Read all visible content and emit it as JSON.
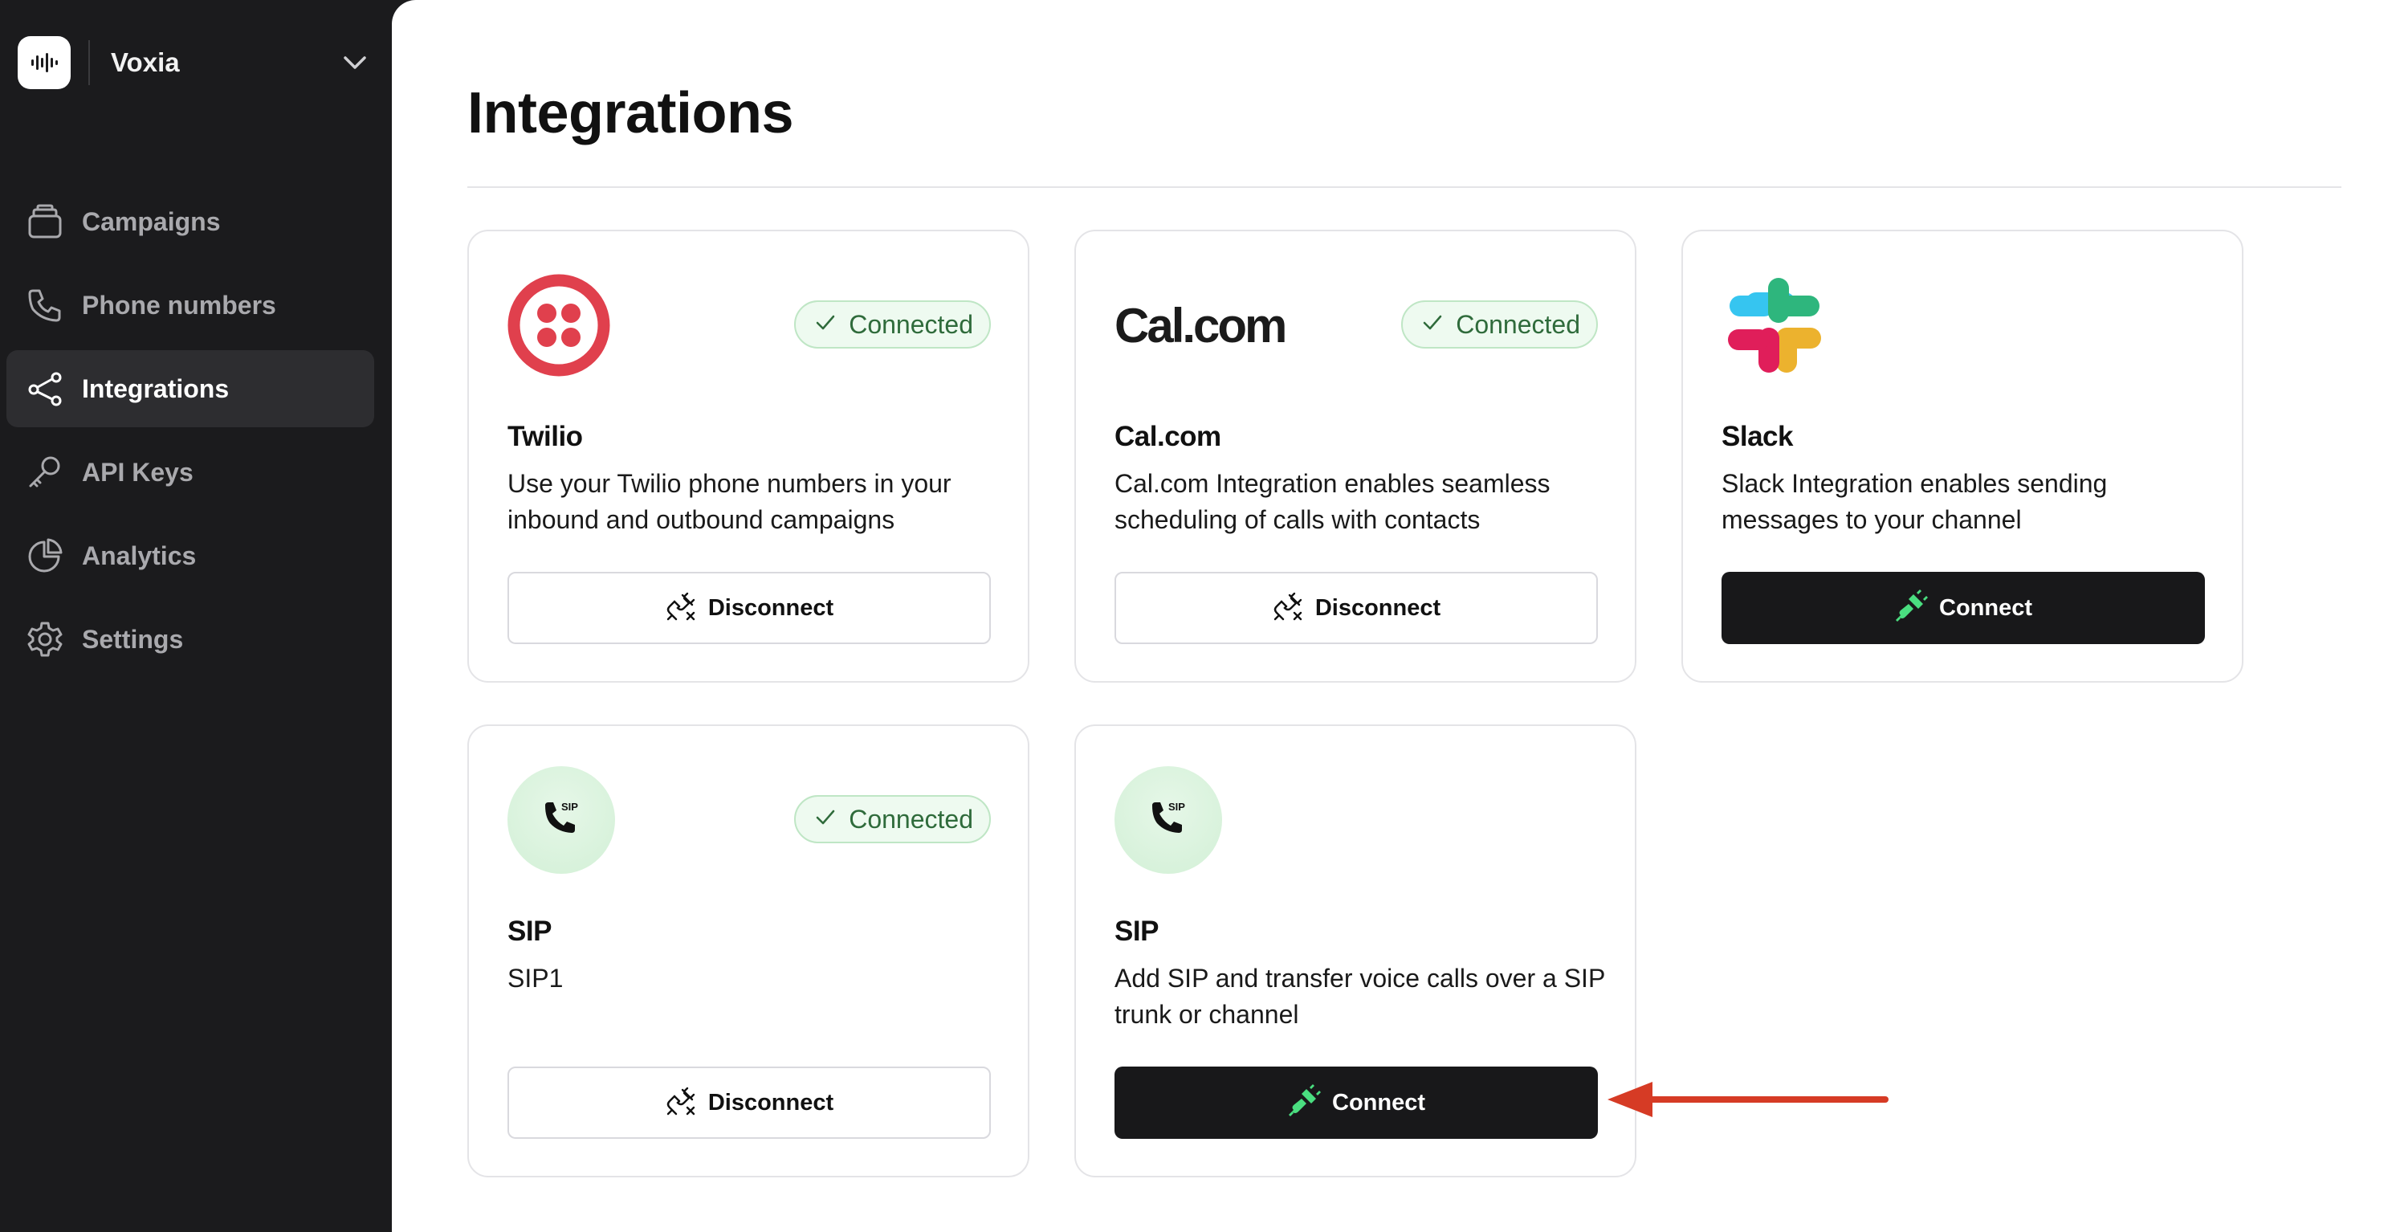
{
  "workspace": {
    "name": "Voxia",
    "logo_icon": "waveform-icon",
    "chevron_icon": "chevron-down-icon"
  },
  "sidebar": {
    "items": [
      {
        "label": "Campaigns",
        "icon": "stack-icon",
        "active": false
      },
      {
        "label": "Phone numbers",
        "icon": "phone-icon",
        "active": false
      },
      {
        "label": "Integrations",
        "icon": "share-nodes-icon",
        "active": true
      },
      {
        "label": "API Keys",
        "icon": "key-icon",
        "active": false
      },
      {
        "label": "Analytics",
        "icon": "pie-chart-icon",
        "active": false
      },
      {
        "label": "Settings",
        "icon": "gear-icon",
        "active": false
      }
    ]
  },
  "main": {
    "title": "Integrations",
    "cards": [
      {
        "title": "Twilio",
        "description": "Use your Twilio phone numbers in your inbound and outbound campaigns",
        "status": "Connected",
        "button": "Disconnect",
        "logo": "twilio-logo"
      },
      {
        "title": "Cal.com",
        "logo_text": "Cal.com",
        "description": "Cal.com Integration enables seamless scheduling of calls with contacts",
        "status": "Connected",
        "button": "Disconnect",
        "logo": "calcom-logo"
      },
      {
        "title": "Slack",
        "description": "Slack Integration enables sending messages to your channel",
        "status": "",
        "button": "Connect",
        "logo": "slack-logo"
      },
      {
        "title": "SIP",
        "description": "SIP1",
        "status": "Connected",
        "button": "Disconnect",
        "logo": "sip-phone-icon"
      },
      {
        "title": "SIP",
        "description": "Add SIP and transfer voice calls over a SIP trunk or channel",
        "status": "",
        "button": "Connect",
        "logo": "sip-phone-icon"
      }
    ]
  },
  "colors": {
    "sidebar_bg": "#1b1b1d",
    "badge_green": "#2f6b3b",
    "connect_plug_green": "#4ade80",
    "annotation_arrow": "#d63b25",
    "twilio_red": "#e0404d"
  }
}
